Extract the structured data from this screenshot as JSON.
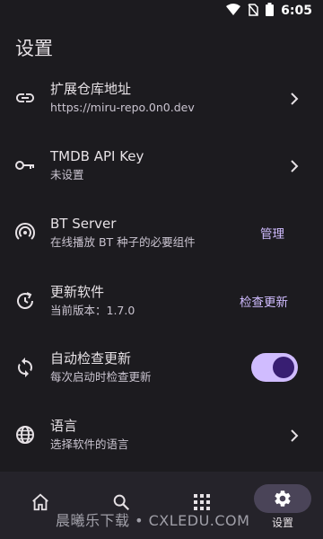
{
  "status_bar": {
    "time": "6:05"
  },
  "page": {
    "title": "设置"
  },
  "settings": [
    {
      "title": "扩展仓库地址",
      "subtitle": "https://miru-repo.0n0.dev",
      "icon": "link-icon"
    },
    {
      "title": "TMDB API Key",
      "subtitle": "未设置",
      "icon": "key-icon"
    },
    {
      "title": "BT Server",
      "subtitle": "在线播放 BT 种子的必要组件",
      "action": "管理",
      "icon": "broadcast-icon"
    },
    {
      "title": "更新软件",
      "subtitle": "当前版本：1.7.0",
      "action": "检查更新",
      "icon": "update-icon"
    },
    {
      "title": "自动检查更新",
      "subtitle": "每次启动时检查更新",
      "toggle_on": true,
      "icon": "sync-icon"
    },
    {
      "title": "语言",
      "subtitle": "选择软件的语言",
      "icon": "globe-icon"
    }
  ],
  "bottom_nav": {
    "items": [
      {
        "icon": "home-icon",
        "label": ""
      },
      {
        "icon": "search-icon",
        "label": ""
      },
      {
        "icon": "grid-icon",
        "label": ""
      },
      {
        "icon": "gear-icon",
        "label": "设置",
        "active": true
      }
    ]
  },
  "watermark": "晨曦乐下载 • CXLEDU.COM",
  "colors": {
    "background": "#1c1b1f",
    "accent": "#d0bcff",
    "toggle_knob": "#381e72",
    "nav_background": "#25232a"
  }
}
